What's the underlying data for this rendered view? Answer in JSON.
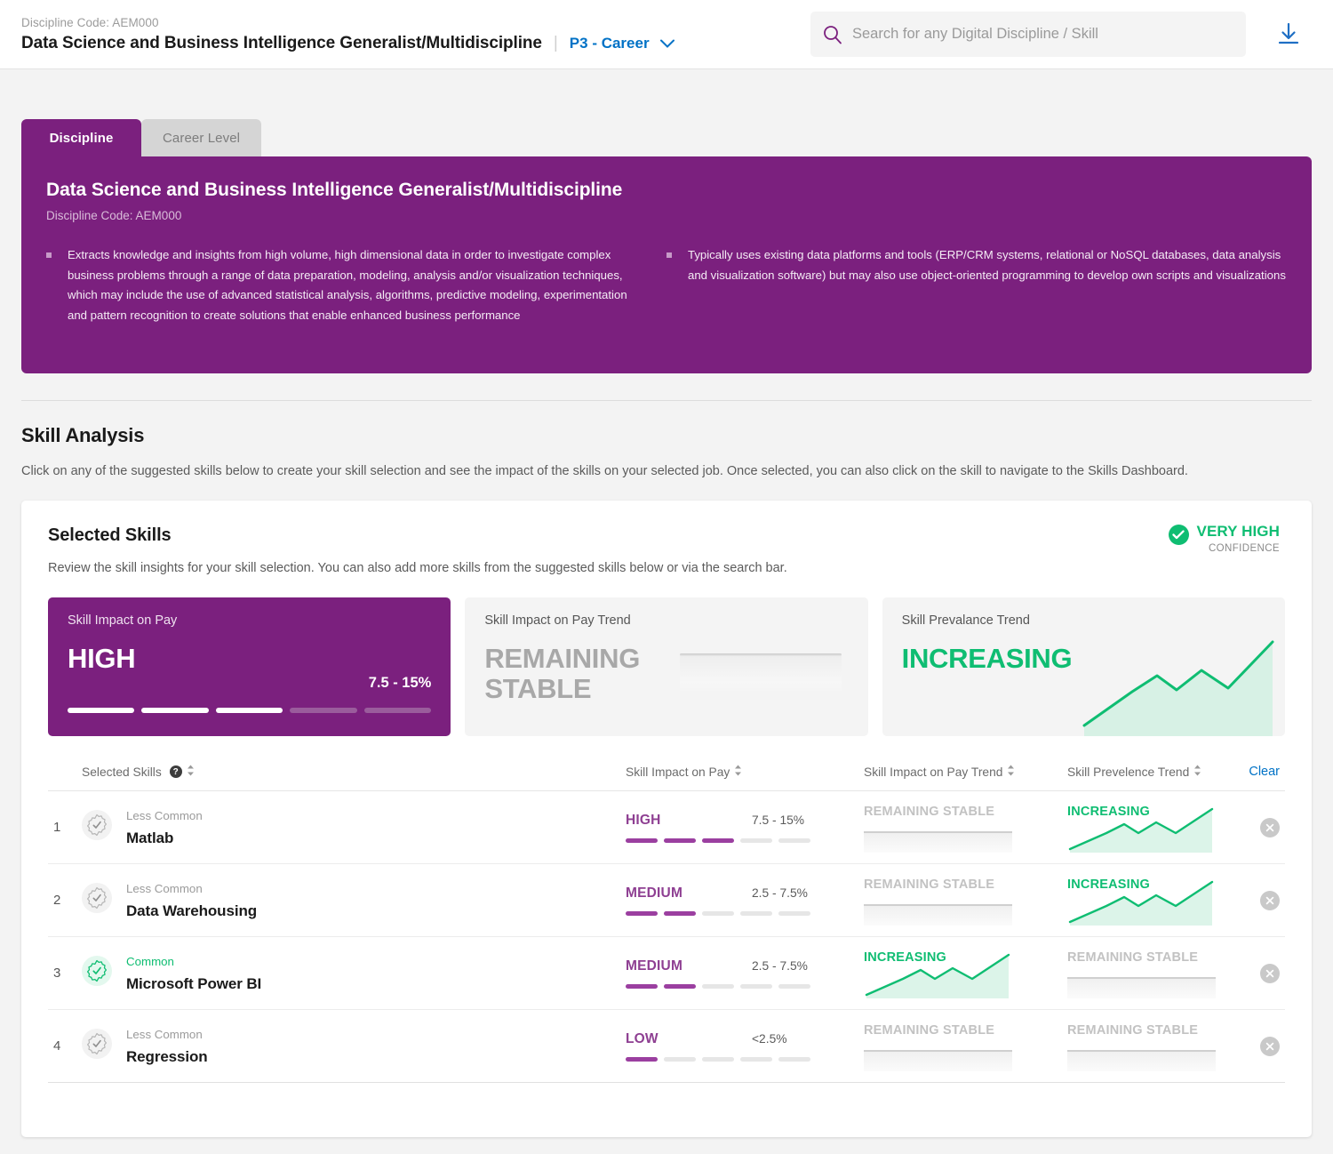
{
  "header": {
    "discipline_code_label": "Discipline Code: AEM000",
    "discipline_title": "Data Science and Business Intelligence Generalist/Multidiscipline",
    "separator": "|",
    "career_level": "P3 - Career",
    "search_placeholder": "Search for any Digital Discipline / Skill",
    "search_value": ""
  },
  "tabs": [
    {
      "label": "Discipline",
      "active": true
    },
    {
      "label": "Career Level",
      "active": false
    }
  ],
  "discipline_card": {
    "title": "Data Science and Business Intelligence Generalist/Multidiscipline",
    "code": "Discipline Code: AEM000",
    "bullets_left": [
      "Extracts knowledge and insights from high volume, high dimensional data in order to investigate complex business problems through a range of data preparation, modeling, analysis and/or visualization techniques, which may include the use of advanced statistical analysis, algorithms, predictive modeling, experimentation and pattern recognition to create solutions that enable enhanced business performance"
    ],
    "bullets_right": [
      "Typically uses existing data platforms and tools (ERP/CRM systems, relational or NoSQL databases, data analysis and visualization software) but may also use object-oriented programming to develop own scripts and visualizations"
    ]
  },
  "skill_analysis": {
    "title": "Skill Analysis",
    "description": "Click on any of the suggested skills below to create your skill selection and see the impact of the skills on your selected job. Once selected, you can also click on the skill to navigate to the Skills Dashboard."
  },
  "selected_skills": {
    "title": "Selected Skills",
    "subtitle": "Review the skill insights for your skill selection. You can also add more skills from the suggested skills below or via the search bar.",
    "confidence_level": "VERY HIGH",
    "confidence_label": "CONFIDENCE"
  },
  "summary_cards": [
    {
      "label": "Skill Impact on Pay",
      "value": "HIGH",
      "range": "7.5 - 15%",
      "filled": 3,
      "total": 5,
      "style": "purple"
    },
    {
      "label": "Skill Impact on Pay Trend",
      "value": "REMAINING STABLE",
      "style": "flat"
    },
    {
      "label": "Skill Prevalance Trend",
      "value": "INCREASING",
      "style": "rising"
    }
  ],
  "table": {
    "columns": {
      "skills": "Selected Skills",
      "pay": "Skill Impact on Pay",
      "pay_trend": "Skill Impact on Pay Trend",
      "prevalence": "Skill Prevelence Trend",
      "clear": "Clear",
      "help_glyph": "?"
    },
    "rows": [
      {
        "num": "1",
        "commonality": "Less Common",
        "common": false,
        "name": "Matlab",
        "pay_level": "HIGH",
        "pay_range": "7.5 - 15%",
        "pay_filled": 3,
        "pay_total": 5,
        "pay_trend": "REMAINING STABLE",
        "pay_trend_rising": false,
        "prevalence_trend": "INCREASING",
        "prevalence_rising": true
      },
      {
        "num": "2",
        "commonality": "Less Common",
        "common": false,
        "name": "Data Warehousing",
        "pay_level": "MEDIUM",
        "pay_range": "2.5 - 7.5%",
        "pay_filled": 2,
        "pay_total": 5,
        "pay_trend": "REMAINING STABLE",
        "pay_trend_rising": false,
        "prevalence_trend": "INCREASING",
        "prevalence_rising": true
      },
      {
        "num": "3",
        "commonality": "Common",
        "common": true,
        "name": "Microsoft Power BI",
        "pay_level": "MEDIUM",
        "pay_range": "2.5 - 7.5%",
        "pay_filled": 2,
        "pay_total": 5,
        "pay_trend": "INCREASING",
        "pay_trend_rising": true,
        "prevalence_trend": "REMAINING STABLE",
        "prevalence_rising": false
      },
      {
        "num": "4",
        "commonality": "Less Common",
        "common": false,
        "name": "Regression",
        "pay_level": "LOW",
        "pay_range": "<2.5%",
        "pay_filled": 1,
        "pay_total": 5,
        "pay_trend": "REMAINING STABLE",
        "pay_trend_rising": false,
        "prevalence_trend": "REMAINING STABLE",
        "prevalence_rising": false
      }
    ]
  },
  "colors": {
    "brand_purple": "#7b207e",
    "accent_purple": "#9b3fa0",
    "green": "#0fbd72",
    "link_blue": "#0072c6",
    "muted_grey": "#c2c2c2"
  }
}
